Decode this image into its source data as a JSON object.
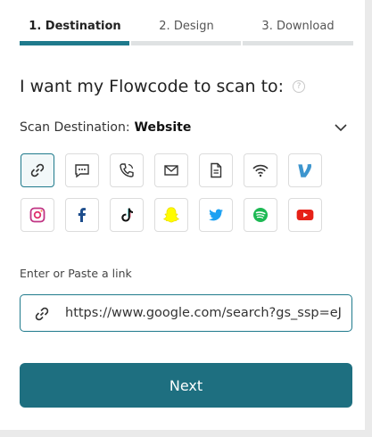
{
  "steps": [
    {
      "label": "1. Destination",
      "active": true
    },
    {
      "label": "2. Design",
      "active": false
    },
    {
      "label": "3. Download",
      "active": false
    }
  ],
  "heading": "I want my Flowcode to scan to:",
  "help_glyph": "?",
  "destination": {
    "label": "Scan Destination:",
    "value": "Website"
  },
  "icons_row1": [
    "link-icon",
    "sms-icon",
    "phone-icon",
    "email-icon",
    "document-icon",
    "wifi-icon",
    "venmo-icon"
  ],
  "icons_row2": [
    "instagram-icon",
    "facebook-icon",
    "tiktok-icon",
    "snapchat-icon",
    "twitter-icon",
    "spotify-icon",
    "youtube-icon"
  ],
  "link_input": {
    "label": "Enter or Paste a link",
    "value": "https://www.google.com/search?gs_ssp=eJ"
  },
  "next_label": "Next",
  "colors": {
    "accent": "#1f7a8c",
    "button": "#1e6f80"
  }
}
